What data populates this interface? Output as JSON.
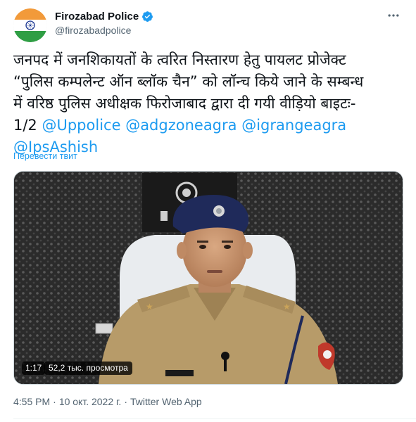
{
  "header": {
    "display_name": "Firozabad Police",
    "handle": "@firozabadpolice",
    "more_icon": "more-horizontal-icon",
    "verified_icon": "verified-badge-icon"
  },
  "tweet": {
    "lines": [
      "जनपद में जनशिकायतों के त्वरित निस्तारण हेतु पायलट प्रोजेक्ट",
      "“पुलिस कम्पलेन्ट ऑन ब्लॉक चैन” को लॉन्च किये जाने के सम्बन्ध",
      "में वरिष्ठ पुलिस अधीक्षक फिरोजाबाद द्वारा दी गयी वीड़ियो बाइटः-"
    ],
    "line4_prefix": "1/2 ",
    "mentions": [
      "@Uppolice",
      "@adgzoneagra",
      "@igrangeagra",
      "@IpsAshish"
    ],
    "translate_label": "Перевести твит"
  },
  "media": {
    "duration": "1:17",
    "views": "52,2 тыс. просмотра"
  },
  "meta": {
    "time": "4:55 PM",
    "separator": "·",
    "date": "10 окт. 2022 г.",
    "source": "Twitter Web App"
  },
  "colors": {
    "link": "#1d9bf0",
    "text": "#0f1419",
    "secondary": "#536471",
    "verified": "#1d9bf0"
  }
}
